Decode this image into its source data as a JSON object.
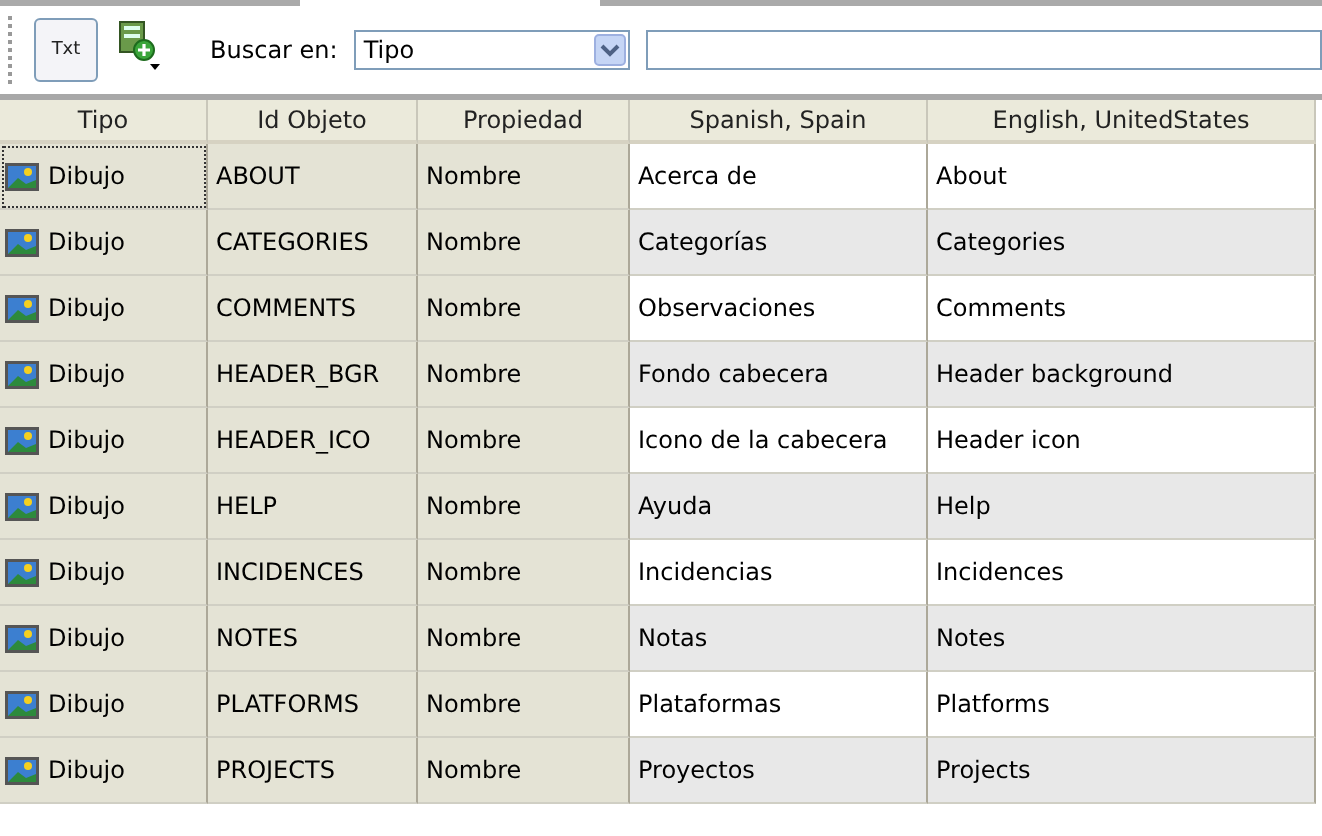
{
  "toolbar": {
    "txt_button": {
      "label": "Txt",
      "pressed": true
    },
    "search_label": "Buscar en:",
    "search_in": {
      "value": "Tipo"
    }
  },
  "table": {
    "columns": [
      "Tipo",
      "Id Objeto",
      "Propiedad",
      "Spanish, Spain",
      "English, UnitedStates"
    ],
    "rows": [
      {
        "tipo": "Dibujo",
        "id": "ABOUT",
        "prop": "Nombre",
        "es": "Acerca de",
        "en": "About",
        "focused": true
      },
      {
        "tipo": "Dibujo",
        "id": "CATEGORIES",
        "prop": "Nombre",
        "es": "Categorías",
        "en": "Categories",
        "focused": false
      },
      {
        "tipo": "Dibujo",
        "id": "COMMENTS",
        "prop": "Nombre",
        "es": "Observaciones",
        "en": "Comments",
        "focused": false
      },
      {
        "tipo": "Dibujo",
        "id": "HEADER_BGR",
        "prop": "Nombre",
        "es": "Fondo cabecera",
        "en": "Header background",
        "focused": false
      },
      {
        "tipo": "Dibujo",
        "id": "HEADER_ICO",
        "prop": "Nombre",
        "es": "Icono de la cabecera",
        "en": "Header icon",
        "focused": false
      },
      {
        "tipo": "Dibujo",
        "id": "HELP",
        "prop": "Nombre",
        "es": "Ayuda",
        "en": "Help",
        "focused": false
      },
      {
        "tipo": "Dibujo",
        "id": "INCIDENCES",
        "prop": "Nombre",
        "es": "Incidencias",
        "en": "Incidences",
        "focused": false
      },
      {
        "tipo": "Dibujo",
        "id": "NOTES",
        "prop": "Nombre",
        "es": "Notas",
        "en": "Notes",
        "focused": false
      },
      {
        "tipo": "Dibujo",
        "id": "PLATFORMS",
        "prop": "Nombre",
        "es": "Plataformas",
        "en": "Platforms",
        "focused": false
      },
      {
        "tipo": "Dibujo",
        "id": "PROJECTS",
        "prop": "Nombre",
        "es": "Proyectos",
        "en": "Projects",
        "focused": false
      }
    ]
  }
}
